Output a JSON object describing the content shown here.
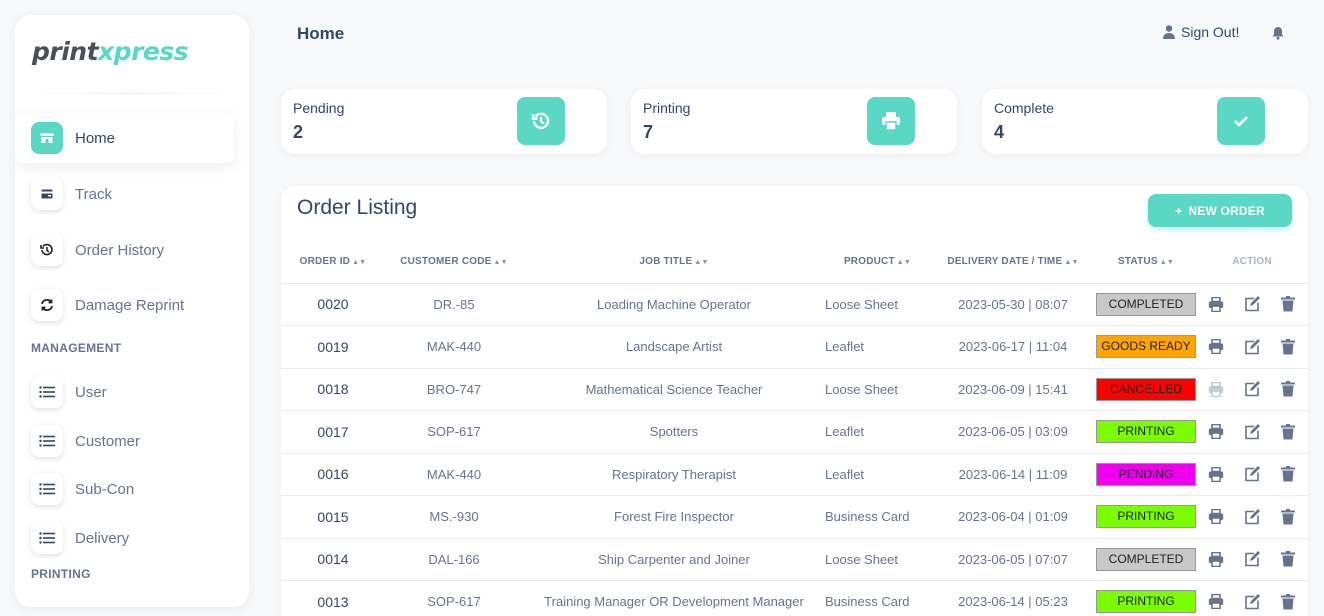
{
  "brand": {
    "part1": "print",
    "part2": "xpress"
  },
  "sidebar": {
    "items": [
      {
        "label": "Home",
        "icon": "shop-icon",
        "active": true
      },
      {
        "label": "Track",
        "icon": "card-icon"
      },
      {
        "label": "Order History",
        "icon": "history-icon"
      },
      {
        "label": "Damage Reprint",
        "icon": "refresh-icon"
      }
    ],
    "management_title": "MANAGEMENT",
    "management_items": [
      {
        "label": "User",
        "icon": "list-icon"
      },
      {
        "label": "Customer",
        "icon": "list-icon"
      },
      {
        "label": "Sub-Con",
        "icon": "list-icon"
      },
      {
        "label": "Delivery",
        "icon": "list-icon"
      }
    ],
    "printing_title": "PRINTING"
  },
  "header": {
    "title": "Home",
    "signout_label": "Sign Out!"
  },
  "stats": [
    {
      "label": "Pending",
      "value": "2",
      "icon": "history-icon"
    },
    {
      "label": "Printing",
      "value": "7",
      "icon": "printer-icon"
    },
    {
      "label": "Complete",
      "value": "4",
      "icon": "check-icon"
    }
  ],
  "orders": {
    "title": "Order Listing",
    "new_order_label": "NEW ORDER",
    "columns": [
      "ORDER ID",
      "CUSTOMER CODE",
      "JOB TITLE",
      "PRODUCT",
      "DELIVERY DATE / TIME",
      "STATUS",
      "ACTION"
    ],
    "rows": [
      {
        "id": "0020",
        "customer": "DR.-85",
        "job": "Loading Machine Operator",
        "product": "Loose Sheet",
        "delivery": "2023-05-30 | 08:07",
        "status": "COMPLETED"
      },
      {
        "id": "0019",
        "customer": "MAK-440",
        "job": "Landscape Artist",
        "product": "Leaflet",
        "delivery": "2023-06-17 | 11:04",
        "status": "GOODS READY"
      },
      {
        "id": "0018",
        "customer": "BRO-747",
        "job": "Mathematical Science Teacher",
        "product": "Loose Sheet",
        "delivery": "2023-06-09 | 15:41",
        "status": "CANCELLED"
      },
      {
        "id": "0017",
        "customer": "SOP-617",
        "job": "Spotters",
        "product": "Leaflet",
        "delivery": "2023-06-05 | 03:09",
        "status": "PRINTING"
      },
      {
        "id": "0016",
        "customer": "MAK-440",
        "job": "Respiratory Therapist",
        "product": "Leaflet",
        "delivery": "2023-06-14 | 11:09",
        "status": "PENDING"
      },
      {
        "id": "0015",
        "customer": "MS.-930",
        "job": "Forest Fire Inspector",
        "product": "Business Card",
        "delivery": "2023-06-04 | 01:09",
        "status": "PRINTING"
      },
      {
        "id": "0014",
        "customer": "DAL-166",
        "job": "Ship Carpenter and Joiner",
        "product": "Loose Sheet",
        "delivery": "2023-06-05 | 07:07",
        "status": "COMPLETED"
      },
      {
        "id": "0013",
        "customer": "SOP-617",
        "job": "Training Manager OR Development Manager",
        "product": "Business Card",
        "delivery": "2023-06-14 | 05:23",
        "status": "PRINTING"
      }
    ]
  },
  "status_colors": {
    "COMPLETED": "#c8c8c8",
    "GOODS READY": "#ffa500",
    "CANCELLED": "#ff0000",
    "PRINTING": "#7cfc00",
    "PENDING": "#ee00ee"
  },
  "colors": {
    "accent": "#5ad7c5",
    "text_dark": "#344767",
    "text_muted": "#67748e"
  }
}
